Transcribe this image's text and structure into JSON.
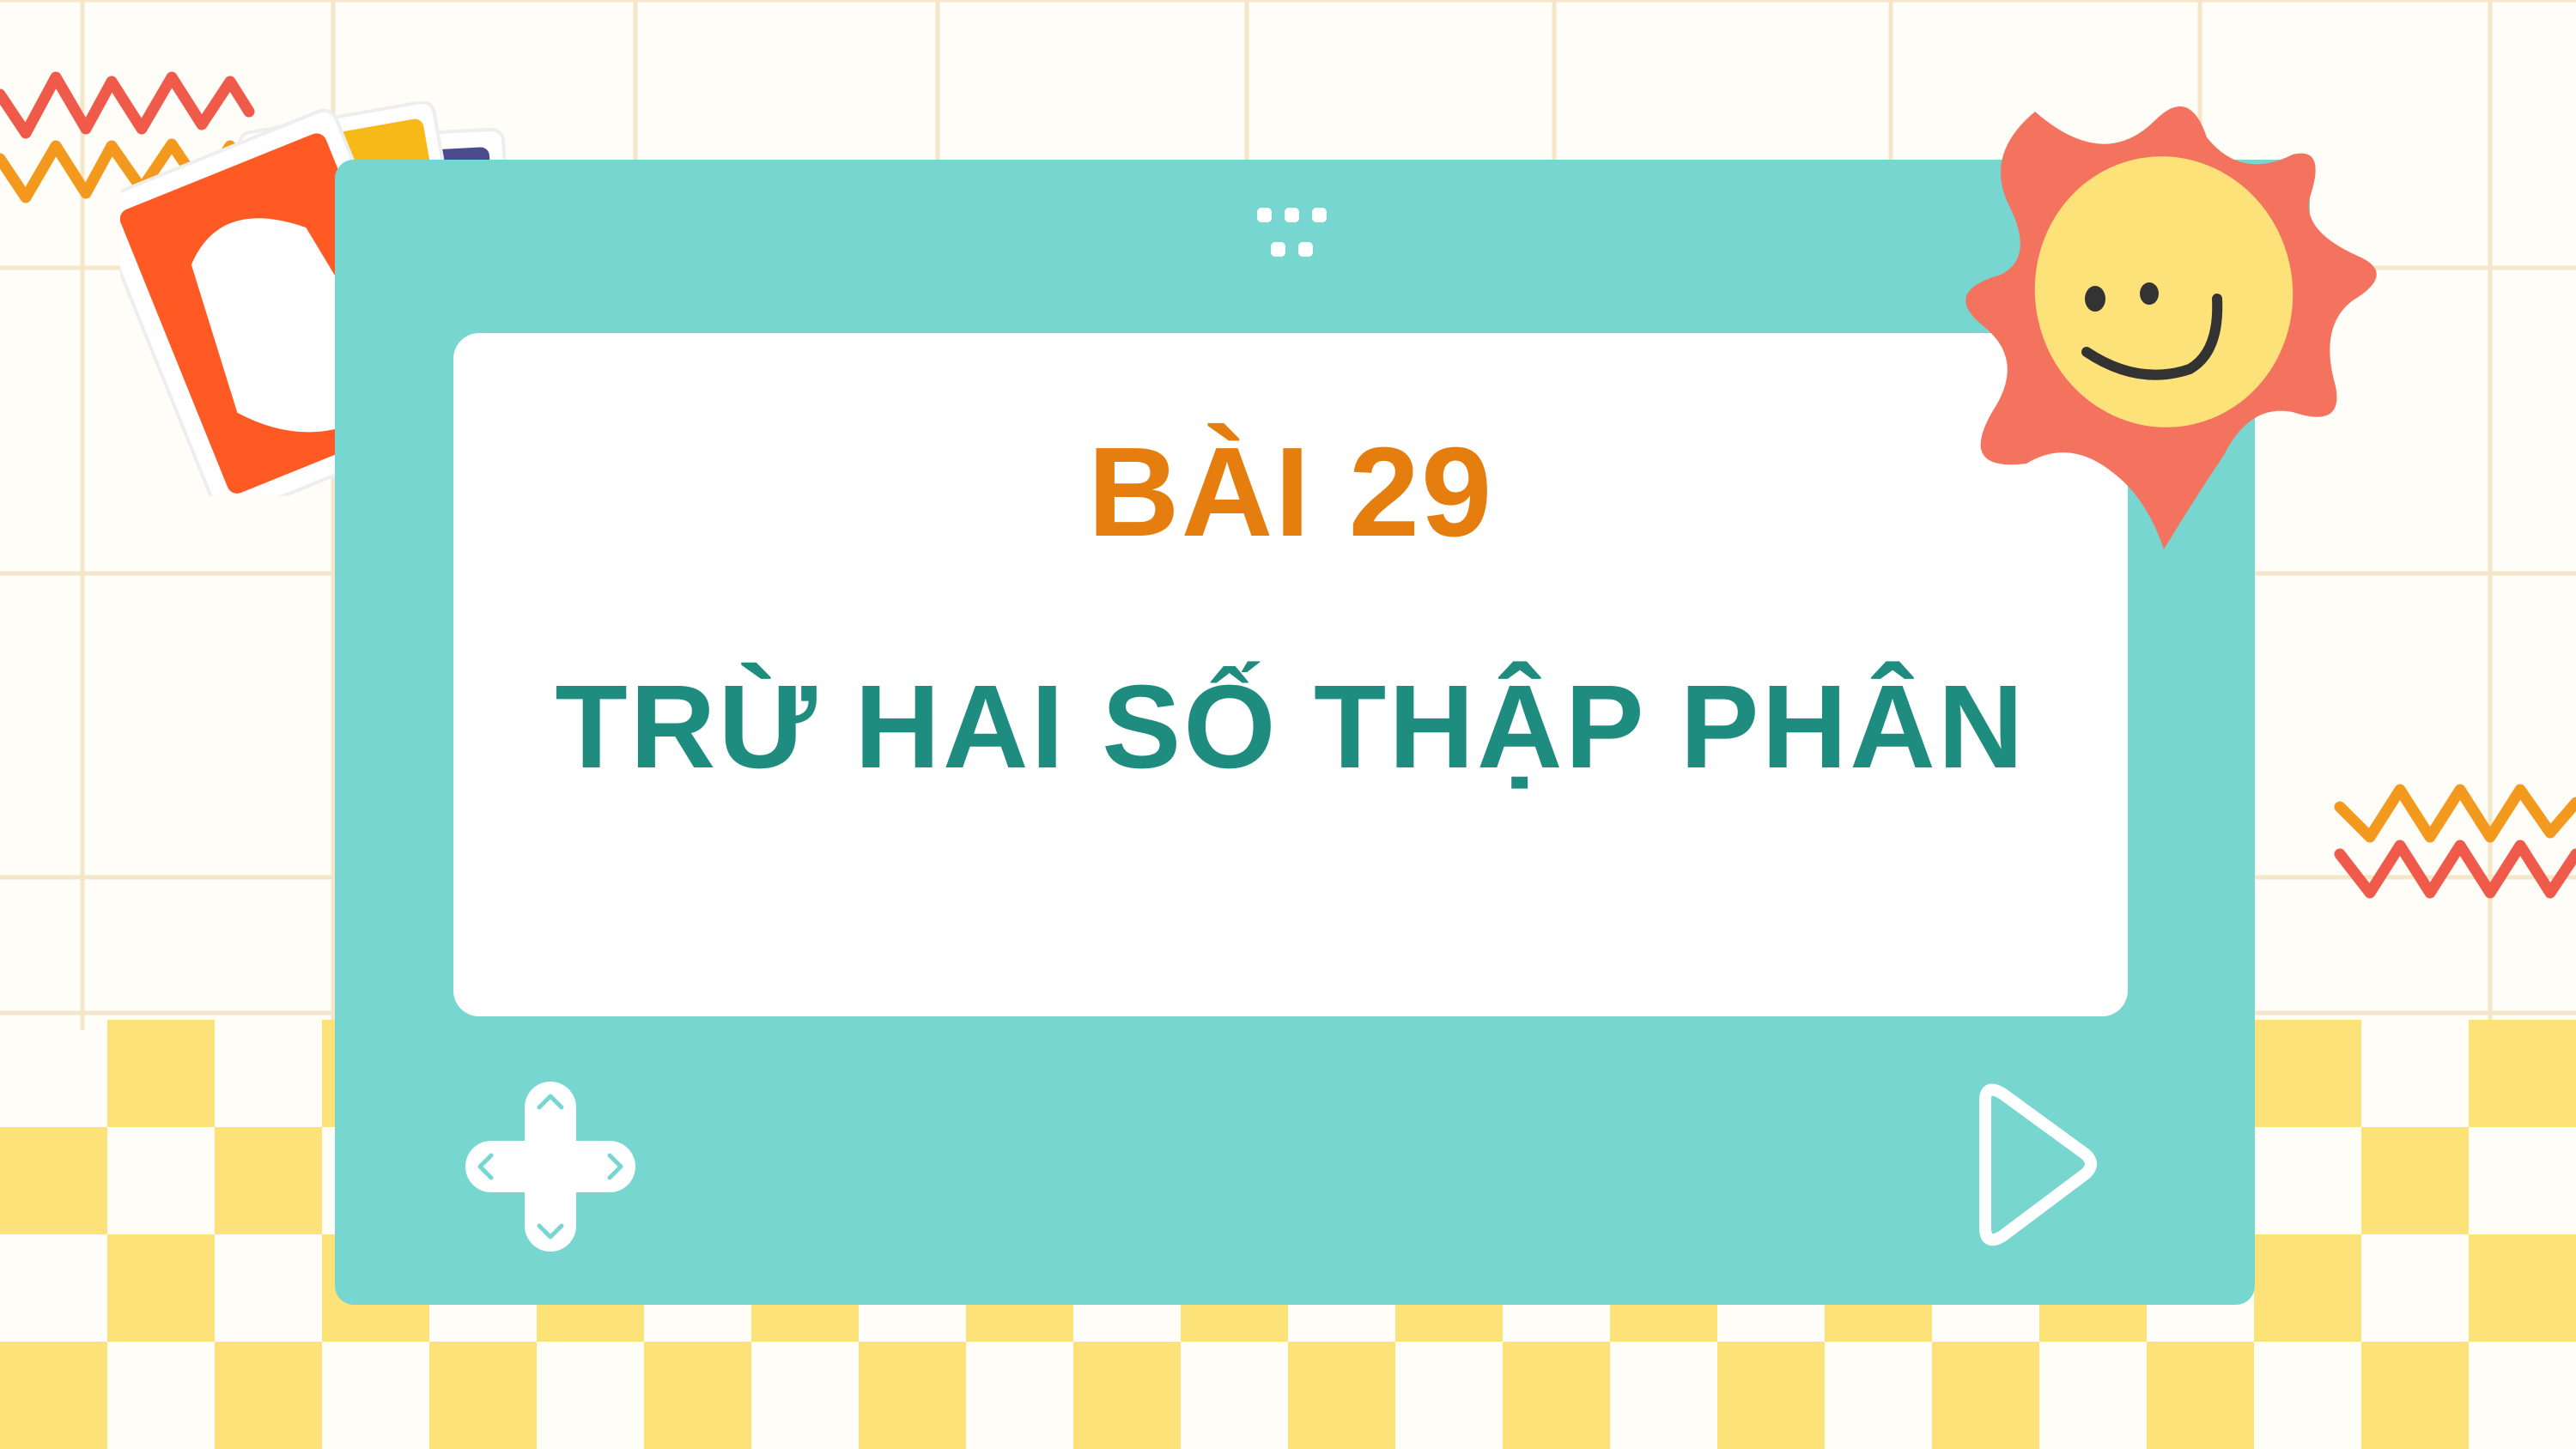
{
  "slide": {
    "lesson_number": "BÀI 29",
    "lesson_title": "TRỪ HAI SỐ THẬP PHÂN"
  },
  "colors": {
    "background": "#fffdf7",
    "grid_lines": "#f5e6c8",
    "checker": "#fde27a",
    "frame": "#77d6cf",
    "screen": "#ffffff",
    "lesson_number": "#e57e0f",
    "lesson_title": "#1f8c80",
    "sun_rays": "#f4735f",
    "sun_face": "#fde27a",
    "zigzag_red": "#f05a4a",
    "zigzag_orange": "#f39a1e"
  },
  "icons": {
    "dots": "six-dots-icon",
    "dpad": "dpad-icon",
    "play": "play-triangle-icon",
    "sun": "smiling-sun-icon",
    "cards": "playing-cards-icon",
    "zigzag": "zigzag-decoration-icon"
  }
}
